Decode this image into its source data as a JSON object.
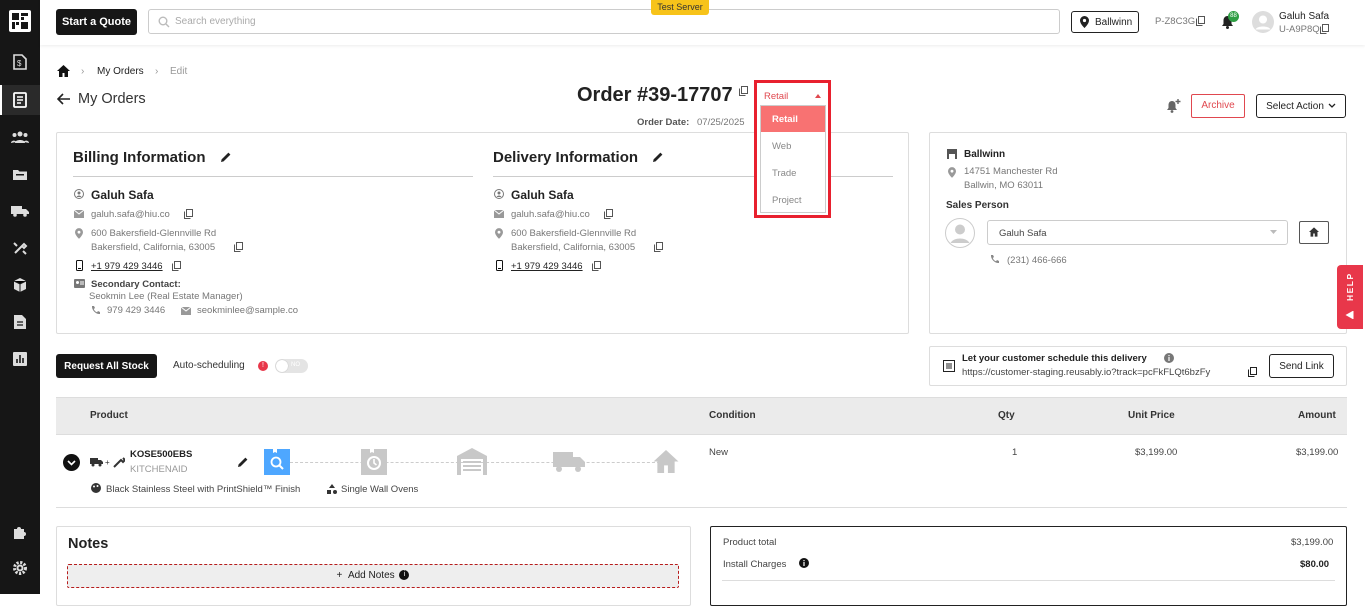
{
  "topbar": {
    "quote_btn": "Start a Quote",
    "search_placeholder": "Search everything",
    "server_badge": "Test Server",
    "location": "Ballwinn",
    "store_code": "P-Z8C3G",
    "notif_count": "88",
    "user_name": "Galuh Safa",
    "user_code": "U-A9P8Q"
  },
  "breadcrumb": {
    "item1": "My Orders",
    "item2": "Edit"
  },
  "page": {
    "back_label": "My Orders",
    "order_title": "Order #39-17707",
    "order_date_label": "Order Date:",
    "order_date": "07/25/2025",
    "archive": "Archive",
    "select_action": "Select Action"
  },
  "type_dropdown": {
    "selected": "Retail",
    "options": [
      "Retail",
      "Web",
      "Trade",
      "Project"
    ]
  },
  "billing": {
    "title": "Billing Information",
    "name": "Galuh Safa",
    "email": "galuh.safa@hiu.co",
    "addr1": "600 Bakersfield-Glennville Rd",
    "addr2": "Bakersfield, California, 63005",
    "phone": "+1 979 429 3446",
    "secondary_label": "Secondary Contact:",
    "secondary_name": "Seokmin Lee (Real Estate Manager)",
    "secondary_phone": "979 429 3446",
    "secondary_email": "seokminlee@sample.co"
  },
  "delivery": {
    "title": "Delivery Information",
    "name": "Galuh Safa",
    "email": "galuh.safa@hiu.co",
    "addr1": "600 Bakersfield-Glennville Rd",
    "addr2": "Bakersfield, California, 63005",
    "phone": "+1 979 429 3446"
  },
  "store": {
    "name": "Ballwinn",
    "addr1": "14751 Manchester Rd",
    "addr2": "Ballwin, MO 63011",
    "sales_label": "Sales Person",
    "sales_person": "Galuh Safa",
    "sales_phone": "(231) 466-666"
  },
  "stock": {
    "request_btn": "Request All Stock",
    "auto_label": "Auto-scheduling",
    "toggle_text": "NO"
  },
  "schedule": {
    "title": "Let your customer schedule this delivery",
    "url": "https://customer-staging.reusably.io?track=pcFkFLQt6bzFy",
    "send_btn": "Send Link"
  },
  "table": {
    "headers": {
      "product": "Product",
      "condition": "Condition",
      "qty": "Qty",
      "unit_price": "Unit Price",
      "amount": "Amount"
    },
    "row": {
      "sku": "KOSE500EBS",
      "brand": "KITCHENAID",
      "condition": "New",
      "qty": "1",
      "unit_price": "$3,199.00",
      "amount": "$3,199.00",
      "color": "Black Stainless Steel with PrintShield™ Finish",
      "category": "Single Wall Ovens"
    }
  },
  "notes": {
    "title": "Notes",
    "add_btn": "Add Notes"
  },
  "totals": {
    "product_total_label": "Product total",
    "product_total": "$3,199.00",
    "install_label": "Install Charges",
    "install": "$80.00"
  },
  "help": "HELP"
}
